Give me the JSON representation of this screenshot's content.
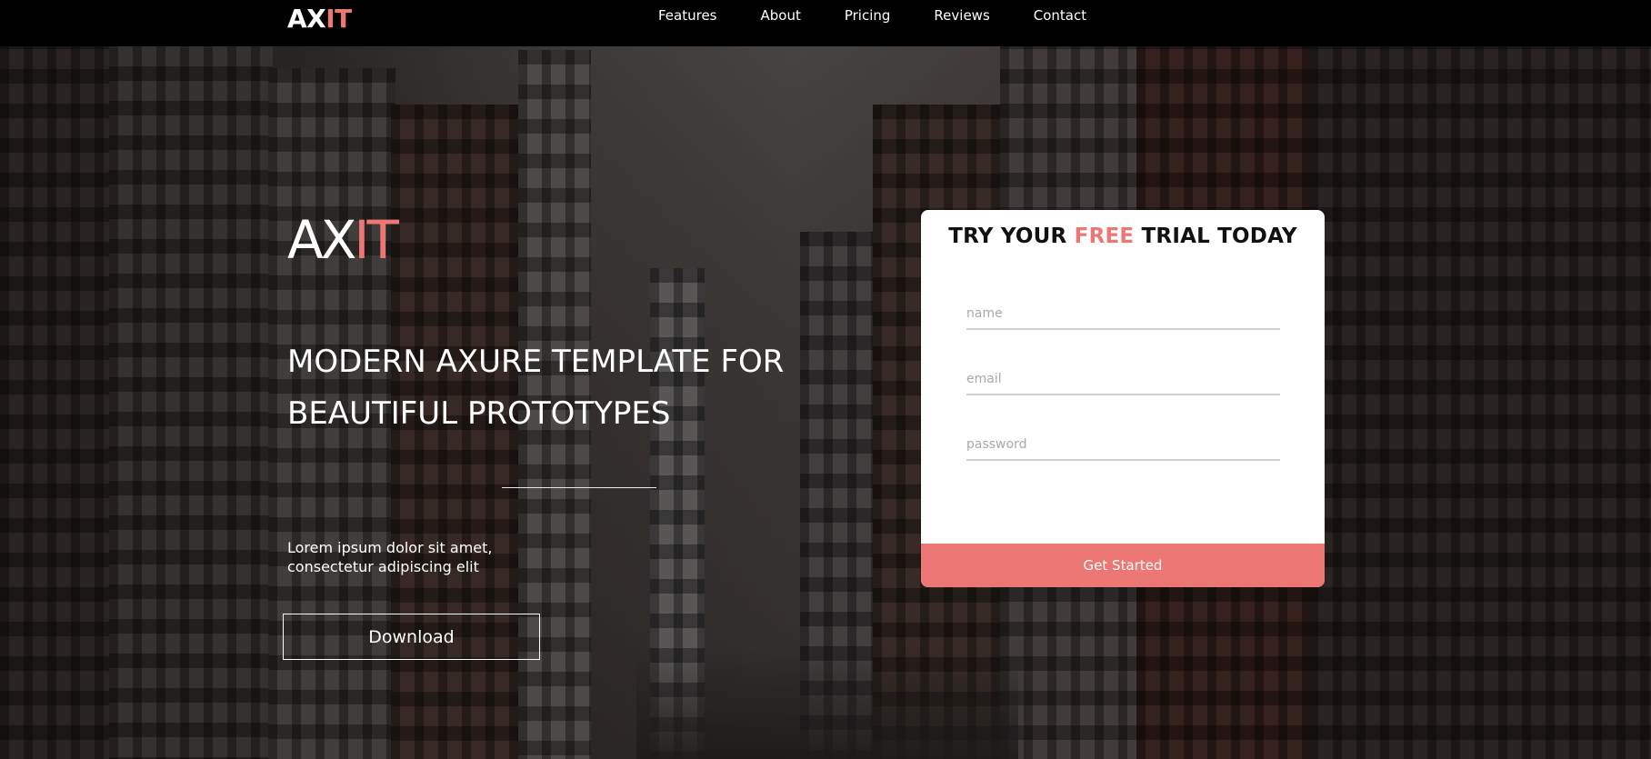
{
  "colors": {
    "accent": "#ec7774",
    "nav_bg": "#000000",
    "card_bg": "#ffffff"
  },
  "brand": {
    "prefix": "AX",
    "accent": "IT"
  },
  "nav": {
    "items": [
      {
        "label": "Features"
      },
      {
        "label": "About"
      },
      {
        "label": "Pricing"
      },
      {
        "label": "Reviews"
      },
      {
        "label": "Contact"
      }
    ]
  },
  "hero": {
    "logo_prefix": "AX",
    "logo_accent": "IT",
    "headline_line1": "MODERN AXURE TEMPLATE FOR",
    "headline_line2": "BEAUTIFUL PROTOTYPES",
    "lead_line1": "Lorem ipsum dolor sit amet,",
    "lead_line2": "consectetur adipiscing elit",
    "download_label": "Download"
  },
  "signup": {
    "title_pre": "TRY YOUR ",
    "title_accent": "FREE",
    "title_post": " TRIAL TODAY",
    "name_placeholder": "name",
    "email_placeholder": "email",
    "password_placeholder": "password",
    "submit_label": "Get Started"
  }
}
